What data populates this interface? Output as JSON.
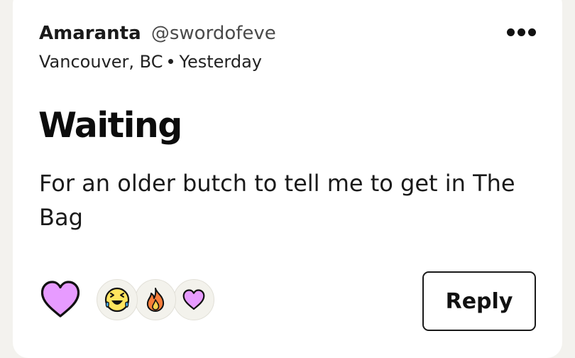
{
  "post": {
    "author_name": "Amaranta",
    "author_handle": "@swordofeve",
    "location": "Vancouver, BC",
    "time": "Yesterday",
    "title": "Waiting",
    "body": "For an older butch to tell me to get in The Bag"
  },
  "actions": {
    "more_icon": "more-horizontal-icon",
    "like_icon": "heart-icon",
    "reply_label": "Reply",
    "reactions": [
      {
        "icon": "laughing-tears-face-icon"
      },
      {
        "icon": "fire-icon"
      },
      {
        "icon": "heart-icon"
      }
    ]
  },
  "colors": {
    "heart_fill": "#e79bff",
    "heart_outline": "#111111",
    "emoji_yellow": "#ffe45e",
    "fire_orange": "#f97d3a",
    "card_bg": "#ffffff",
    "page_bg": "#f3f2ee"
  }
}
